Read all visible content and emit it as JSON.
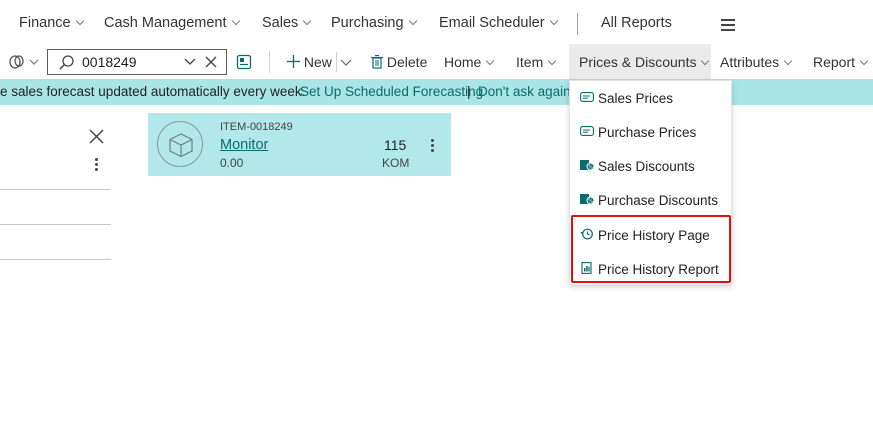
{
  "nav": {
    "items": [
      "Finance",
      "Cash Management",
      "Sales",
      "Purchasing",
      "Email Scheduler"
    ],
    "all_reports": "All Reports"
  },
  "actionbar": {
    "search_value": "0018249",
    "new_label": "New",
    "delete_label": "Delete",
    "menus": [
      "Home",
      "Item",
      "Prices & Discounts",
      "Attributes",
      "Report"
    ]
  },
  "notification": {
    "message": "e sales forecast updated automatically every week.",
    "link_setup": "Set Up Scheduled Forecasting",
    "link_separator": "|",
    "link_dismiss": "Don't ask again"
  },
  "card": {
    "item_number": "ITEM-0018249",
    "name": "Monitor",
    "price": "0.00",
    "quantity": "115",
    "unit": "KOM"
  },
  "dropdown": {
    "items": [
      {
        "label": "Sales Prices",
        "icon": "price-list-icon"
      },
      {
        "label": "Purchase Prices",
        "icon": "price-list-icon"
      },
      {
        "label": "Sales Discounts",
        "icon": "discount-icon"
      },
      {
        "label": "Purchase Discounts",
        "icon": "discount-icon"
      },
      {
        "label": "Price History Page",
        "icon": "history-icon"
      },
      {
        "label": "Price History Report",
        "icon": "report-icon"
      }
    ]
  },
  "colors": {
    "accent_teal": "#a9e5e6",
    "card_bg": "#b2e8ea",
    "link_teal": "#0a6a6d",
    "highlight_red": "#e01010"
  }
}
